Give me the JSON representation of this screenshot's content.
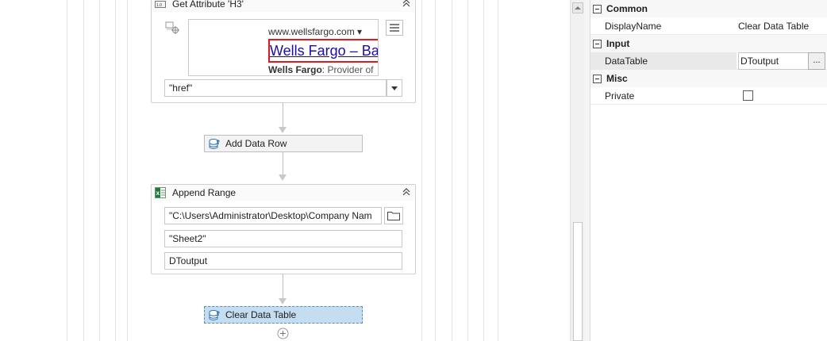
{
  "designer": {
    "get_attribute": {
      "title": "Get Attribute 'H3'",
      "preview": {
        "url": "www.wellsfargo.com",
        "link_text": "Wells Fargo – Ba",
        "desc_bold": "Wells Fargo",
        "desc_rest": ": Provider of"
      },
      "attribute_value": "\"href\""
    },
    "add_data_row": {
      "label": "Add Data Row"
    },
    "append_range": {
      "title": "Append Range",
      "workbook_path": "\"C:\\Users\\Administrator\\Desktop\\Company  Nam",
      "sheet_name": "\"Sheet2\"",
      "datatable": "DToutput"
    },
    "clear_data_table": {
      "label": "Clear Data Table"
    }
  },
  "properties": {
    "categories": [
      {
        "name": "Common",
        "rows": [
          {
            "name": "DisplayName",
            "value": "Clear Data Table"
          }
        ]
      },
      {
        "name": "Input",
        "rows": [
          {
            "name": "DataTable",
            "value": "DToutput",
            "button": "..."
          }
        ]
      },
      {
        "name": "Misc",
        "rows": [
          {
            "name": "Private",
            "checked": false
          }
        ]
      }
    ]
  },
  "colors": {
    "selected_activity": "#c4ddf0",
    "link": "#1a0dab",
    "highlight_border": "#e11b1b"
  }
}
